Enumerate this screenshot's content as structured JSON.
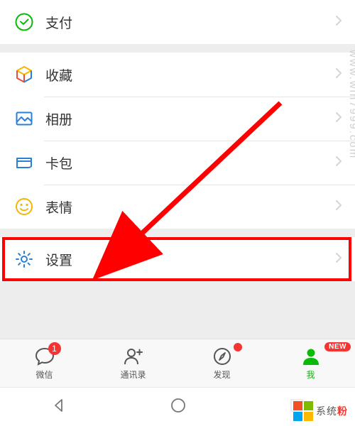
{
  "groups": {
    "pay": {
      "label": "支付",
      "icon": "pay-icon"
    },
    "favorites": {
      "label": "收藏",
      "icon": "cube-icon"
    },
    "album": {
      "label": "相册",
      "icon": "photo-icon"
    },
    "cards": {
      "label": "卡包",
      "icon": "card-icon"
    },
    "stickers": {
      "label": "表情",
      "icon": "smile-icon"
    },
    "settings": {
      "label": "设置",
      "icon": "gear-icon"
    }
  },
  "tabs": {
    "chats": {
      "label": "微信",
      "badge": "1"
    },
    "contacts": {
      "label": "通讯录"
    },
    "discover": {
      "label": "发现",
      "dot": true
    },
    "me": {
      "label": "我",
      "active": true,
      "new": "NEW"
    }
  },
  "watermark": {
    "side": "www.win7999.com",
    "brand_left": "系统",
    "brand_accent": "粉"
  },
  "colors": {
    "accent_green": "#09bb07",
    "accent_blue": "#2a7fd6",
    "accent_yellow": "#f7b500",
    "divider": "#ededed"
  }
}
